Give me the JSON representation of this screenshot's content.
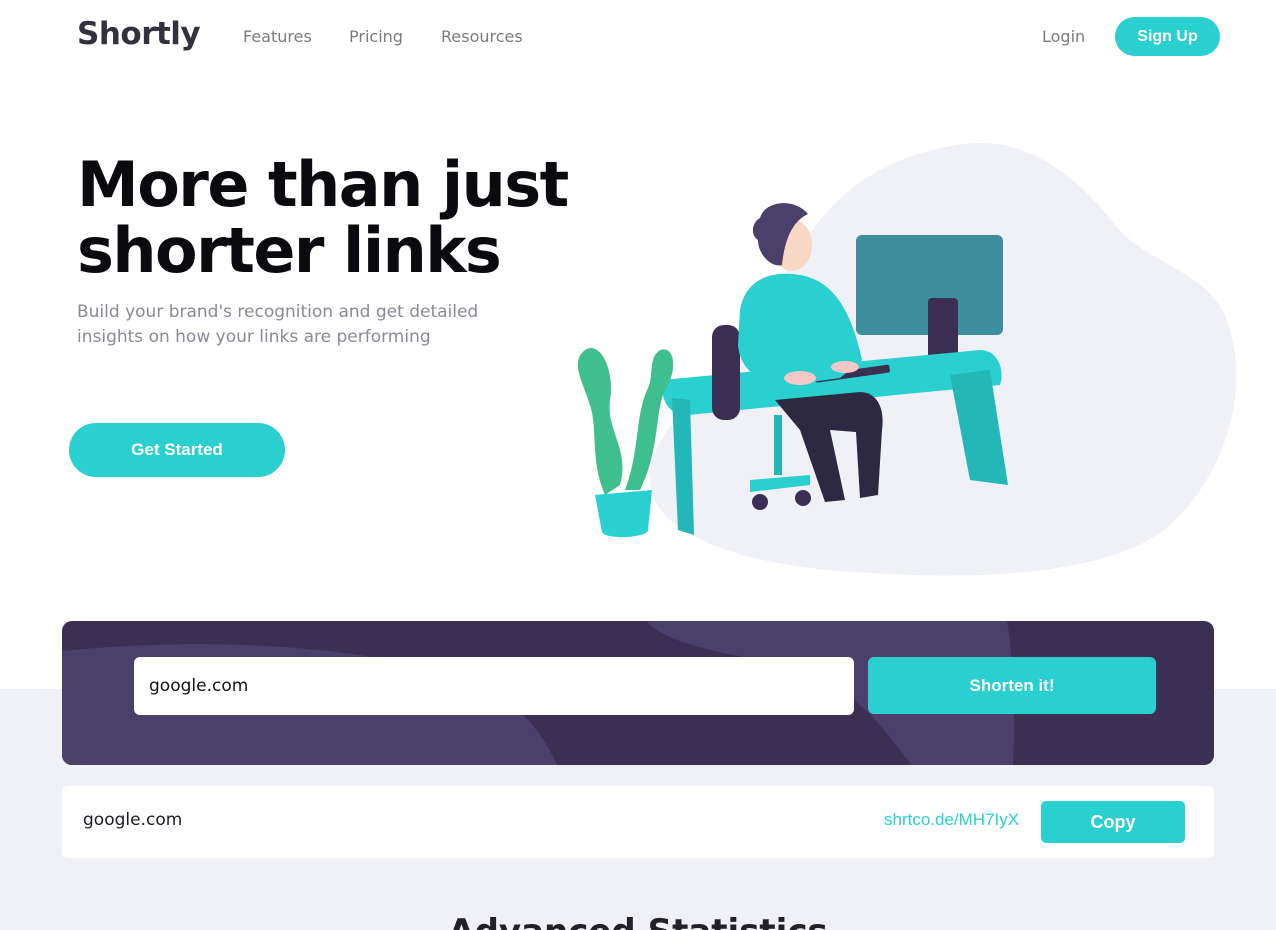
{
  "brand": {
    "logo": "Shortly",
    "accent": "#2acfcf",
    "dark_violet": "#3b3054"
  },
  "nav": {
    "links": [
      "Features",
      "Pricing",
      "Resources"
    ],
    "login": "Login",
    "signup": "Sign Up"
  },
  "hero": {
    "title": "More than just shorter links",
    "subtitle": "Build your brand's recognition and get detailed insights on how your links are performing",
    "cta": "Get Started"
  },
  "shorten": {
    "input_value": "google.com",
    "button": "Shorten it!"
  },
  "results": [
    {
      "original": "google.com",
      "short": "shrtco.de/MH7IyX",
      "copy_label": "Copy"
    }
  ],
  "next_section": {
    "heading": "Advanced Statistics"
  }
}
